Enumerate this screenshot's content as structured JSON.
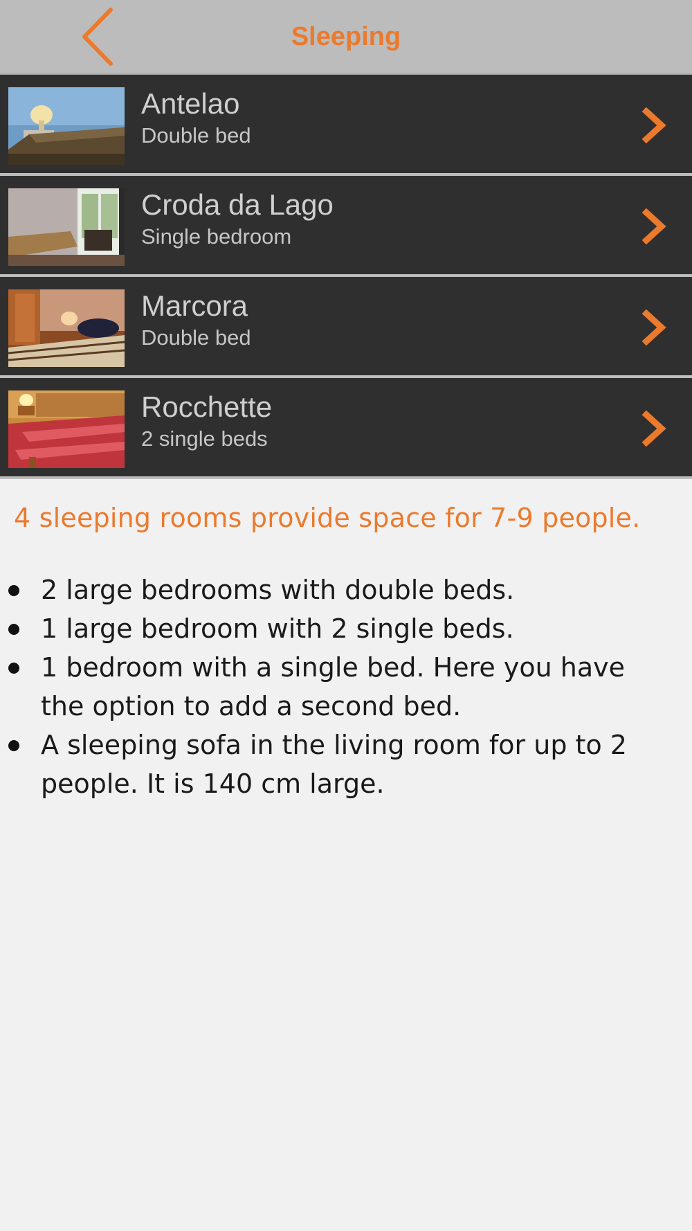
{
  "colors": {
    "accent": "#ec7a2d",
    "navbar_bg": "#bcbcbc",
    "row_bg": "#2f2f2f"
  },
  "header": {
    "title": "Sleeping",
    "back_icon": "chevron-left-icon"
  },
  "rooms": [
    {
      "name": "Antelao",
      "description": "Double bed",
      "thumbnail": "bedroom-photo-blue-wall",
      "chevron_icon": "chevron-right-icon"
    },
    {
      "name": "Croda da Lago",
      "description": "Single bedroom",
      "thumbnail": "bedroom-photo-window-balcony",
      "chevron_icon": "chevron-right-icon"
    },
    {
      "name": "Marcora",
      "description": "Double bed",
      "thumbnail": "bedroom-photo-wood-wardrobe",
      "chevron_icon": "chevron-right-icon"
    },
    {
      "name": "Rocchette",
      "description": "2 single beds",
      "thumbnail": "bedroom-photo-red-checkered-beds",
      "chevron_icon": "chevron-right-icon"
    }
  ],
  "info": {
    "headline": "4 sleeping rooms provide space for 7-9 people.",
    "bullets": [
      "2 large bedrooms with double beds.",
      "1 large bedroom with 2 single beds.",
      "1 bedroom with a single bed. Here you have the option to add a second bed.",
      "A sleeping sofa in the living room for up to 2 people. It is 140 cm large."
    ]
  }
}
